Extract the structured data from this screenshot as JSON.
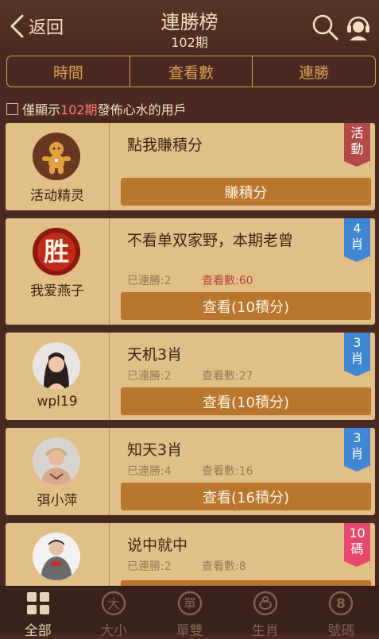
{
  "header": {
    "back_label": "返回",
    "title": "連勝榜",
    "subtitle": "102期"
  },
  "tabs": [
    "時間",
    "查看數",
    "連勝"
  ],
  "filter": {
    "prefix": "僅顯示",
    "period": "102期",
    "suffix": "發佈心水的用戶"
  },
  "cards": [
    {
      "user": "活动精灵",
      "title": "點我賺積分",
      "button": "賺積分",
      "badge": [
        "活",
        "動"
      ],
      "avatar_icon": "gingerbread-icon"
    },
    {
      "user": "我爱燕子",
      "title": "不看单双家野，本期老曾",
      "streak_label": "已連勝:2",
      "views_label": "查看數:60",
      "button": "查看(10積分)",
      "badge": [
        "4",
        "肖"
      ],
      "avatar_icon": "win-character-icon",
      "avatar_char": "胜"
    },
    {
      "user": "wpl19",
      "title": "天机3肖",
      "streak_label": "已連勝:2",
      "views_label": "查看數:27",
      "button": "查看(10積分)",
      "badge": [
        "3",
        "肖"
      ],
      "avatar_icon": "woman-photo-icon"
    },
    {
      "user": "弭小萍",
      "title": "知天3肖",
      "streak_label": "已連勝:4",
      "views_label": "查看數:16",
      "button": "查看(16積分)",
      "badge": [
        "3",
        "肖"
      ],
      "avatar_icon": "man-photo-icon"
    },
    {
      "user": "",
      "title": "说中就中",
      "streak_label": "已連勝:2",
      "views_label": "查看數:8",
      "badge": [
        "10",
        "碼"
      ],
      "avatar_icon": "person-photo-icon"
    }
  ],
  "nav": [
    {
      "label": "全部",
      "icon": "grid-icon",
      "active": true
    },
    {
      "label": "大小",
      "icon": "big-char-icon",
      "glyph": "大"
    },
    {
      "label": "單雙",
      "icon": "single-char-icon",
      "glyph": "單"
    },
    {
      "label": "生肖",
      "icon": "zodiac-icon"
    },
    {
      "label": "號碼",
      "icon": "number-eight-icon",
      "glyph": "8"
    }
  ],
  "colors": {
    "background": "#4a2a20",
    "card": "#e1bf87",
    "button": "#b8762e",
    "tab_border": "#d9a15a",
    "badge_red": "#b14a48",
    "badge_blue": "#3f86d3",
    "badge_pink": "#e5496c"
  }
}
